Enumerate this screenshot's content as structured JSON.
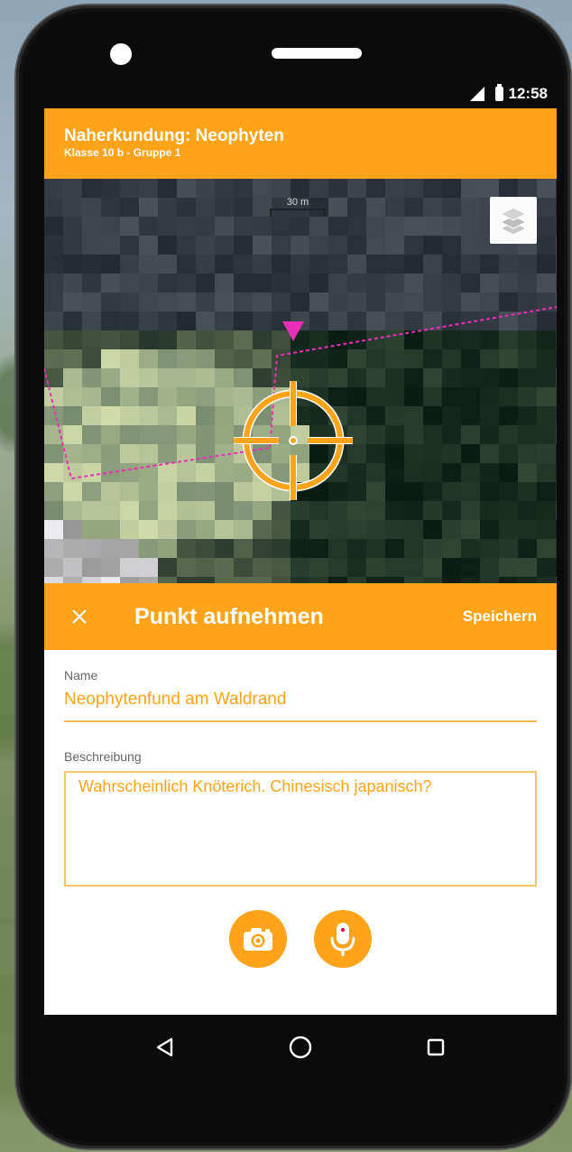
{
  "status": {
    "time": "12:58"
  },
  "app_bar": {
    "title": "Naherkundung: Neophyten",
    "subtitle": "Klasse 10 b - Gruppe 1"
  },
  "map": {
    "scale_label": "30 m",
    "colors": {
      "track": "#e82fb8",
      "marker": "#e82fb8",
      "crosshair": "#ffa31a"
    }
  },
  "panel": {
    "title": "Punkt aufnehmen",
    "save_label": "Speichern"
  },
  "form": {
    "name_label": "Name",
    "name_value": "Neophytenfund am Waldrand",
    "description_label": "Beschreibung",
    "description_value": "Wahrscheinlich Knöterich. Chinesisch japanisch?"
  },
  "icons": [
    "close-icon",
    "layers-icon",
    "camera-icon",
    "microphone-icon",
    "back-icon",
    "home-icon",
    "recents-icon"
  ],
  "theme": {
    "accent": "#ffa31a"
  }
}
